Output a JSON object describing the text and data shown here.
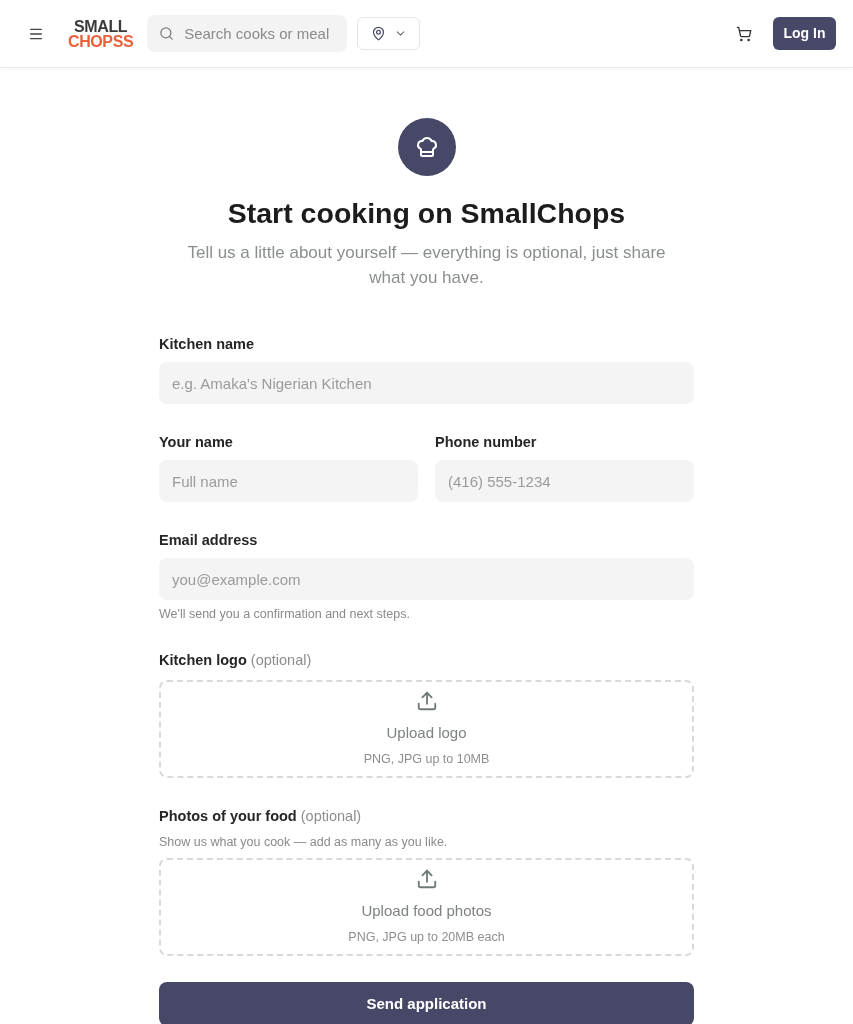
{
  "header": {
    "logo": {
      "line_1": "SMALL",
      "line_2": "CHOPSS"
    },
    "search": {
      "placeholder": "Search cooks or meal"
    },
    "login_button": "Log In"
  },
  "intro": {
    "title": "Start cooking on SmallChops",
    "subtitle": "Tell us a little about yourself — everything is optional, just share what you have."
  },
  "form": [
    {
      "kind": "input",
      "label": "Kitchen name",
      "placeholder": "e.g. Amaka's Nigerian Kitchen"
    },
    {
      "kind": "pair",
      "fields": [
        {
          "label": "Your name",
          "placeholder": "Full name"
        },
        {
          "label": "Phone number",
          "placeholder": "(416) 555-1234"
        }
      ]
    },
    {
      "kind": "input",
      "label": "Email address",
      "placeholder": "you@example.com",
      "hint": "We'll send you a confirmation and next steps."
    },
    {
      "kind": "upload",
      "label": "Kitchen logo",
      "note": "(optional)",
      "title": "Upload logo",
      "limits": "PNG, JPG up to 10MB"
    },
    {
      "kind": "upload",
      "label": "Photos of your food",
      "note": "(optional)",
      "hint": "Show us what you cook — add as many as you like.",
      "title": "Upload food photos",
      "limits": "PNG, JPG up to 20MB each"
    }
  ],
  "submit_button": "Send application"
}
